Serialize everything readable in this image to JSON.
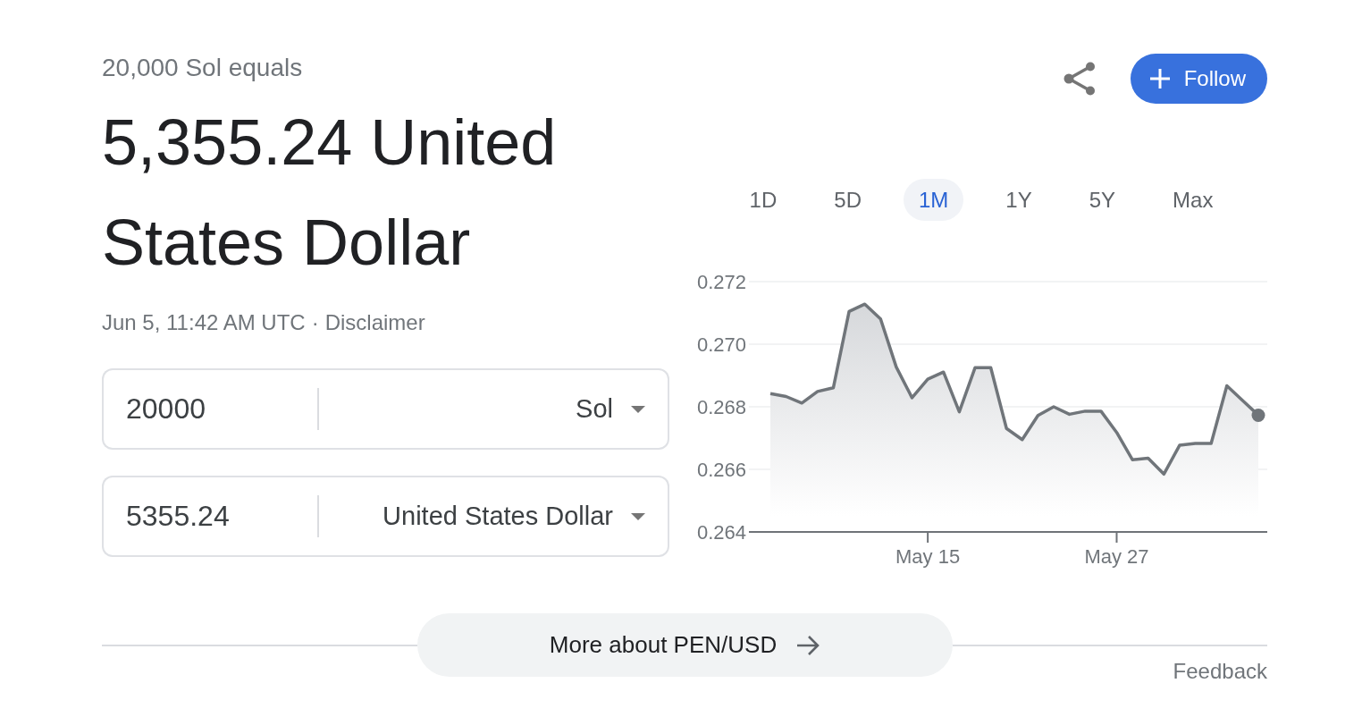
{
  "summary": {
    "equals_text": "20,000 Sol equals",
    "result": "5,355.24 United States Dollar",
    "timestamp": "Jun 5, 11:42 AM UTC",
    "separator": "·",
    "disclaimer": "Disclaimer"
  },
  "follow_button": {
    "label": "Follow"
  },
  "converter": [
    {
      "value": "20000",
      "currency": "Sol"
    },
    {
      "value": "5355.24",
      "currency": "United States Dollar"
    }
  ],
  "chart": {
    "ranges": [
      {
        "label": "1D",
        "selected": false
      },
      {
        "label": "5D",
        "selected": false
      },
      {
        "label": "1M",
        "selected": true
      },
      {
        "label": "1Y",
        "selected": false
      },
      {
        "label": "5Y",
        "selected": false
      },
      {
        "label": "Max",
        "selected": false
      }
    ],
    "chart_data": {
      "type": "area",
      "categories": [
        null,
        null,
        null,
        null,
        null,
        null,
        null,
        null,
        null,
        null,
        "May 15",
        null,
        null,
        null,
        null,
        null,
        null,
        null,
        null,
        null,
        null,
        null,
        "May 27",
        null,
        null,
        null,
        null,
        null,
        null,
        null,
        null,
        null
      ],
      "series": [
        {
          "color": "#70757a",
          "values": [
            0.26842,
            0.26833,
            0.26812,
            0.26849,
            0.26861,
            0.27105,
            0.27128,
            0.27081,
            0.26927,
            0.26829,
            0.26888,
            0.26911,
            0.26784,
            0.26925,
            0.26925,
            0.26731,
            0.26695,
            0.26772,
            0.268,
            0.26776,
            0.26786,
            0.26786,
            0.26718,
            0.26631,
            0.26636,
            0.26585,
            0.26677,
            0.26683,
            0.26683,
            0.26867,
            0.2682,
            0.26773
          ]
        }
      ],
      "ylim": [
        0.264,
        0.272
      ],
      "yticks": [
        {
          "value": 0.264,
          "label": "0.264"
        },
        {
          "value": 0.266,
          "label": "0.266"
        },
        {
          "value": 0.268,
          "label": "0.268"
        },
        {
          "value": 0.27,
          "label": "0.270"
        },
        {
          "value": 0.272,
          "label": "0.272"
        }
      ],
      "grid": true
    }
  },
  "more_button": {
    "label": "More about PEN/USD"
  },
  "feedback_link": "Feedback"
}
